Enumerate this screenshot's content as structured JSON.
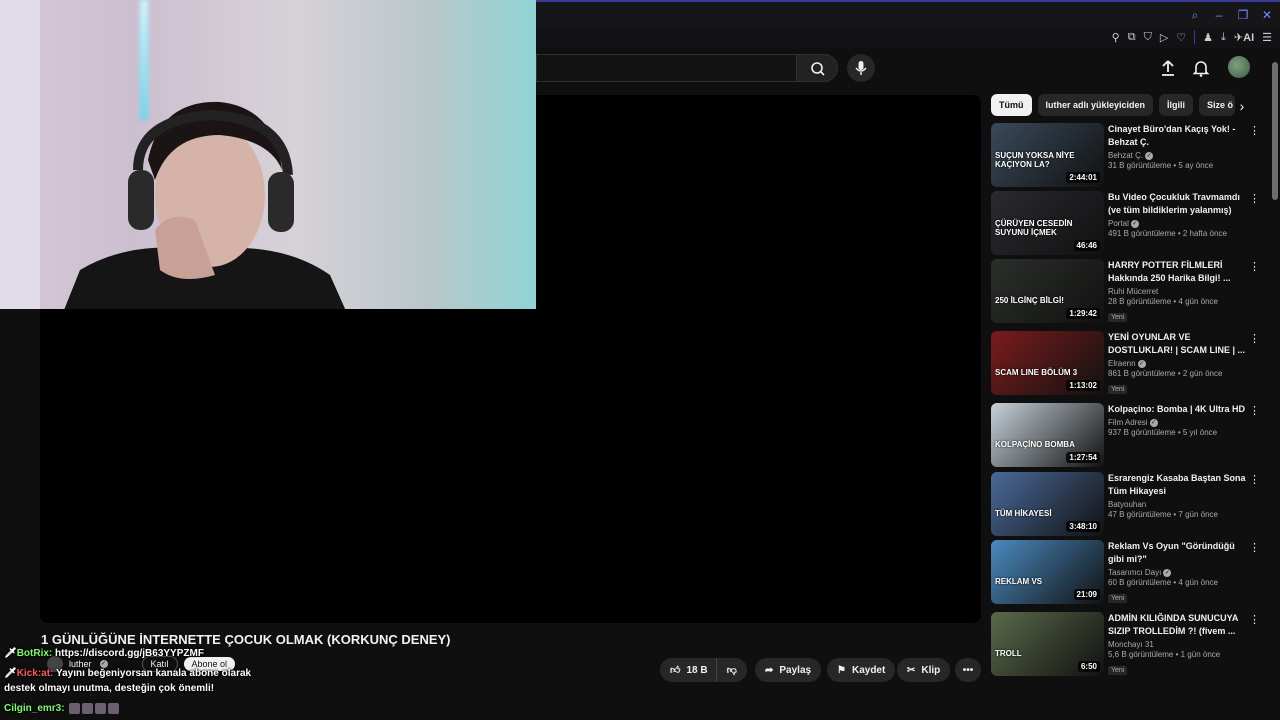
{
  "video": {
    "title": "1 GÜNLÜĞÜNE İNTERNETTE ÇOCUK OLMAK (KORKUNÇ DENEY)",
    "channel": "luther",
    "join_label": "Katıl",
    "subscribe_label": "Abone ol",
    "likes": "18 B",
    "share_label": "Paylaş",
    "save_label": "Kaydet",
    "clip_label": "Klip"
  },
  "chips": [
    {
      "label": "Tümü",
      "active": true
    },
    {
      "label": "luther adlı yükleyiciden",
      "active": false
    },
    {
      "label": "İlgili",
      "active": false
    },
    {
      "label": "Size ö",
      "active": false
    }
  ],
  "recommendations": [
    {
      "title": "Cinayet Büro'dan Kaçış Yok! - Behzat Ç.",
      "channel": "Behzat Ç.",
      "verified": true,
      "views": "31 B görüntüleme",
      "age": "5 ay önce",
      "duration": "2:44:01",
      "badge": "",
      "thumb_text": "SUÇUN YOKSA NİYE KAÇIYON LA?",
      "thumb_bg": "#3a4a5a"
    },
    {
      "title": "Bu Video Çocukluk Travmamdı (ve tüm bildiklerim yalanmış)",
      "channel": "Portal",
      "verified": true,
      "views": "491 B görüntüleme",
      "age": "2 hafta önce",
      "duration": "46:46",
      "badge": "",
      "thumb_text": "ÇÜRÜYEN CESEDİN SUYUNU İÇMEK",
      "thumb_bg": "#2a2a30"
    },
    {
      "title": "HARRY POTTER FİLMLERİ Hakkında 250 Harika Bilgi! ...",
      "channel": "Ruhi Mücerret",
      "verified": false,
      "views": "28 B görüntüleme",
      "age": "4 gün önce",
      "duration": "1:29:42",
      "badge": "Yeni",
      "thumb_text": "250 İLGİNÇ BİLGİ!",
      "thumb_bg": "#2b2f2a"
    },
    {
      "title": "YENİ OYUNLAR VE DOSTLUKLAR! | SCAM LINE | ...",
      "channel": "Elraenn",
      "verified": true,
      "views": "861 B görüntüleme",
      "age": "2 gün önce",
      "duration": "1:13:02",
      "badge": "Yeni",
      "thumb_text": "SCAM LINE BÖLÜM 3",
      "thumb_bg": "#7a1b1b"
    },
    {
      "title": "Kolpaçino: Bomba | 4K Ultra HD",
      "channel": "Film Adresi",
      "verified": true,
      "views": "937 B görüntüleme",
      "age": "5 yıl önce",
      "duration": "1:27:54",
      "badge": "",
      "thumb_text": "KOLPAÇİNO BOMBA",
      "thumb_bg": "#c7d2da"
    },
    {
      "title": "Esrarengiz Kasaba Baştan Sona Tüm Hikayesi",
      "channel": "Batyouhan",
      "verified": false,
      "views": "47 B görüntüleme",
      "age": "7 gün önce",
      "duration": "3:48:10",
      "badge": "",
      "thumb_text": "TÜM HİKAYESİ",
      "thumb_bg": "#4a6a9a"
    },
    {
      "title": "Reklam Vs Oyun \"Göründüğü gibi mi?\"",
      "channel": "Tasarımcı Dayı",
      "verified": true,
      "views": "60 B görüntüleme",
      "age": "4 gün önce",
      "duration": "21:09",
      "badge": "Yeni",
      "thumb_text": "REKLAM VS",
      "thumb_bg": "#4a8ac0"
    },
    {
      "title": "ADMİN KILIĞINDA SUNUCUYA SIZIP TROLLEDİM ?! (fivem ...",
      "channel": "Monchayı 31",
      "verified": false,
      "views": "5,6 B görüntüleme",
      "age": "1 gün önce",
      "duration": "6:50",
      "badge": "Yeni",
      "thumb_text": "TROLL",
      "thumb_bg": "#5a6a4a"
    }
  ],
  "chat": [
    {
      "user": "BotRix:",
      "message": "https://discord.gg/jB63YYPZMF"
    },
    {
      "user": "Kick:at:",
      "message": "Yayını beğeniyorsan kanala abone olarak"
    },
    {
      "user": "",
      "message": "destek olmayı unutma, desteğin çok önemli!"
    },
    {
      "user": "Cilgin_emr3:",
      "message": ""
    }
  ],
  "icons": {
    "search": "search-icon",
    "mic": "mic-icon",
    "upload": "upload-icon",
    "bell": "bell-icon"
  },
  "extension_bar": {
    "ai_label": "AI"
  }
}
